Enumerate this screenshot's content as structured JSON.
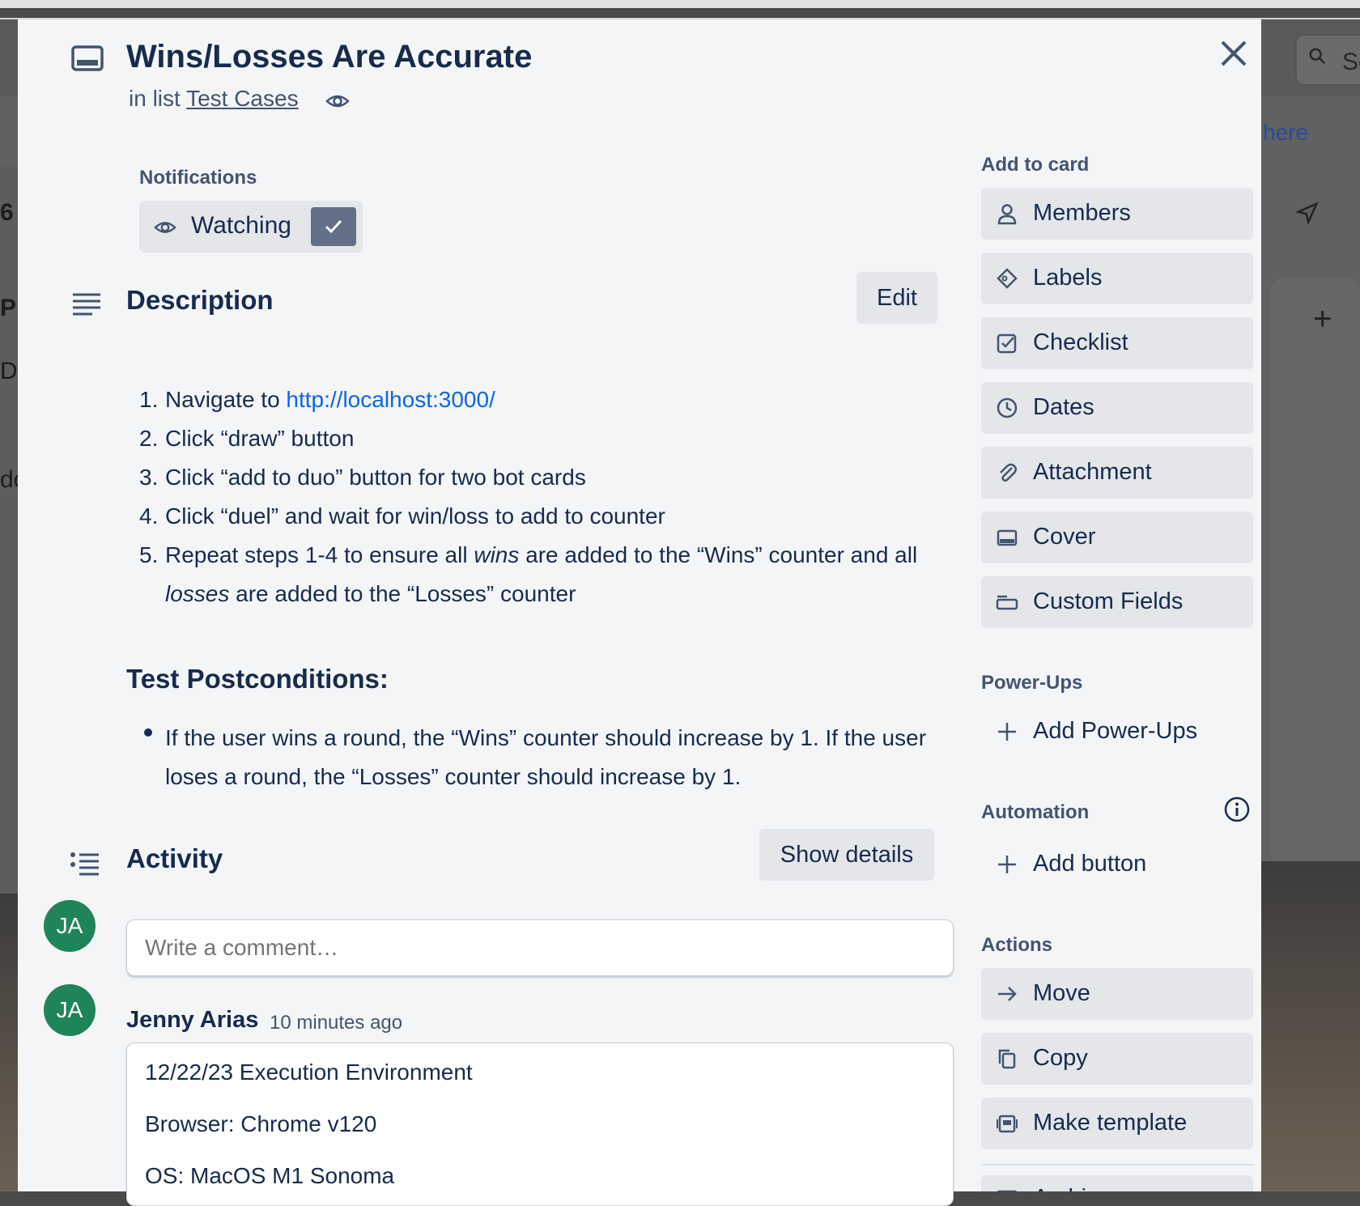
{
  "background": {
    "search_text": "Se",
    "link_text": "here",
    "left_letters": [
      "6",
      "PI",
      "D",
      "do"
    ]
  },
  "card": {
    "title": "Wins/Losses Are Accurate",
    "in_list_prefix": "in list",
    "list_name": "Test Cases"
  },
  "notifications": {
    "label": "Notifications",
    "watch_label": "Watching"
  },
  "description": {
    "title": "Description",
    "edit_label": "Edit",
    "steps": [
      {
        "num": "1.",
        "text": "Navigate to ",
        "link": "http://localhost:3000/"
      },
      {
        "num": "2.",
        "text": "Click “draw” button"
      },
      {
        "num": "3.",
        "text": "Click “add to duo” button for two bot cards"
      },
      {
        "num": "4.",
        "text": "Click “duel” and wait for win/loss to add to counter"
      },
      {
        "num": "5.",
        "text_a": "Repeat steps 1-4 to ensure all ",
        "em_a": "wins",
        "text_b": " are added to the “Wins” counter and all ",
        "em_b": "losses",
        "text_c": " are added to the “Losses” counter"
      }
    ],
    "postconditions_title": "Test Postconditions:",
    "postconditions": [
      "If the user wins a round, the “Wins” counter should increase by 1. If the user loses a round, the “Losses” counter should increase by 1."
    ]
  },
  "activity": {
    "title": "Activity",
    "show_details_label": "Show details",
    "comment_placeholder": "Write a comment…",
    "current_user_initials": "JA",
    "comments": [
      {
        "author": "Jenny Arias",
        "initials": "JA",
        "time": "10 minutes ago",
        "lines": [
          "12/22/23 Execution Environment",
          "Browser: Chrome v120",
          "OS: MacOS M1 Sonoma"
        ]
      }
    ]
  },
  "sidebar": {
    "add_to_card_label": "Add to card",
    "add_to_card": [
      {
        "label": "Members",
        "icon": "person-icon"
      },
      {
        "label": "Labels",
        "icon": "tag-icon"
      },
      {
        "label": "Checklist",
        "icon": "checkbox-icon"
      },
      {
        "label": "Dates",
        "icon": "clock-icon"
      },
      {
        "label": "Attachment",
        "icon": "paperclip-icon"
      },
      {
        "label": "Cover",
        "icon": "cover-icon"
      },
      {
        "label": "Custom Fields",
        "icon": "custom-fields-icon"
      }
    ],
    "powerups_label": "Power-Ups",
    "add_powerups_label": "Add Power-Ups",
    "automation_label": "Automation",
    "add_button_label": "Add button",
    "actions_label": "Actions",
    "actions": [
      {
        "label": "Move",
        "icon": "arrow-right-icon"
      },
      {
        "label": "Copy",
        "icon": "copy-icon"
      },
      {
        "label": "Make template",
        "icon": "template-icon"
      },
      {
        "label": "Archive",
        "icon": "archive-icon"
      }
    ]
  },
  "colors": {
    "modal_bg": "#f4f5f7",
    "button_bg": "#e4e6ea",
    "text": "#172b4d",
    "link": "#0c66e4",
    "avatar": "#1f845a",
    "check_bg": "#626f86"
  }
}
